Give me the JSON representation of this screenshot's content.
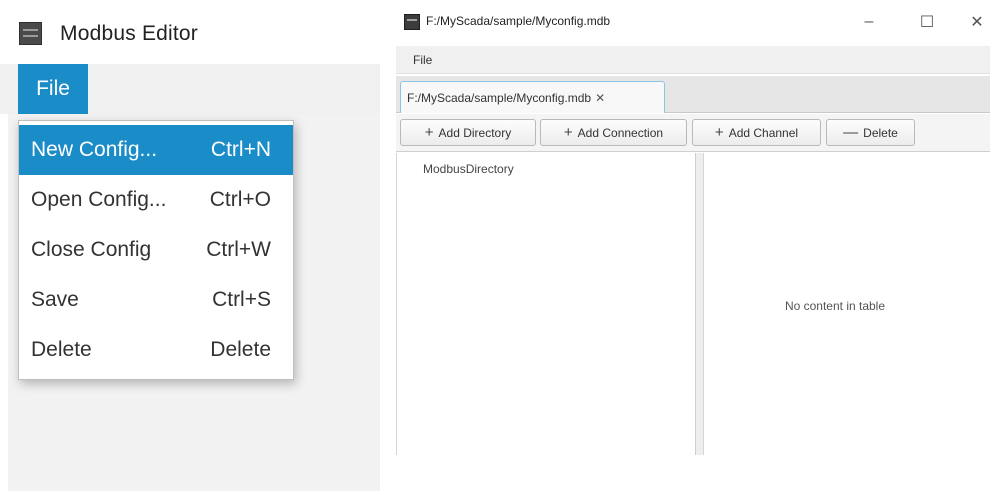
{
  "left_app": {
    "title": "Modbus Editor",
    "menu_file_label": "File",
    "dropdown_items": [
      {
        "label": "New Config...",
        "shortcut": "Ctrl+N"
      },
      {
        "label": "Open Config...",
        "shortcut": "Ctrl+O"
      },
      {
        "label": "Close Config",
        "shortcut": "Ctrl+W"
      },
      {
        "label": "Save",
        "shortcut": "Ctrl+S"
      },
      {
        "label": "Delete",
        "shortcut": "Delete"
      }
    ],
    "active_item_index": 0
  },
  "right_window": {
    "title": "F:/MyScada/sample/Myconfig.mdb",
    "controls": {
      "minimize": "–",
      "maximize": "☐",
      "close": "✕"
    },
    "menu_file_label": "File",
    "tab_label": "F:/MyScada/sample/Myconfig.mdb",
    "tab_close": "✕",
    "toolbar": {
      "add_directory": "Add Directory",
      "add_connection": "Add Connection",
      "add_channel": "Add Channel",
      "delete": "Delete",
      "plus_glyph": "+",
      "minus_glyph": "—"
    },
    "tree_root": "ModbusDirectory",
    "table_empty_text": "No content in table"
  },
  "colors": {
    "accent": "#1a8cc8",
    "menu_background": "#f0f0f0"
  }
}
